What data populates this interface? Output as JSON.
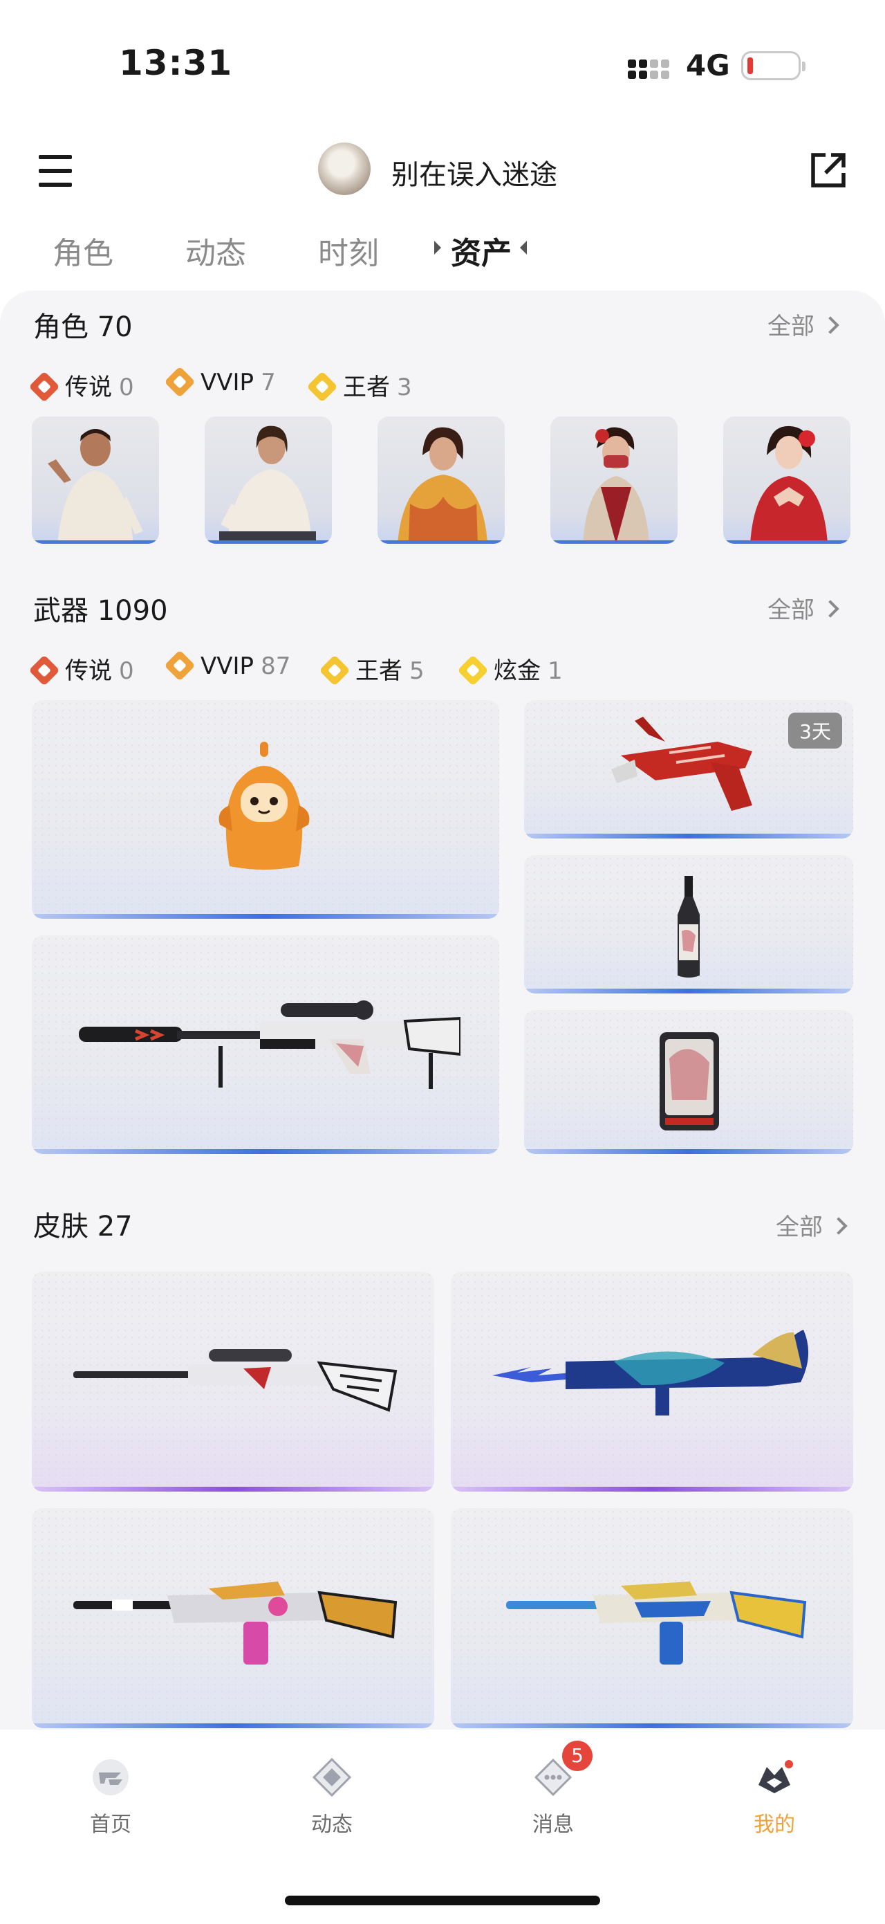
{
  "status_bar": {
    "time": "13:31",
    "network": "4G"
  },
  "header": {
    "username": "别在误入迷途"
  },
  "tabs": [
    {
      "label": "角色",
      "active": false
    },
    {
      "label": "动态",
      "active": false
    },
    {
      "label": "时刻",
      "active": false
    },
    {
      "label": "资产",
      "active": true
    }
  ],
  "roles": {
    "title": "角色",
    "count": "70",
    "see_all": "全部",
    "filters": [
      {
        "label": "传说",
        "count": "0",
        "icon": "legend-badge-icon"
      },
      {
        "label": "VVIP",
        "count": "7",
        "icon": "vvip-badge-icon"
      },
      {
        "label": "王者",
        "count": "3",
        "icon": "king-badge-icon"
      }
    ]
  },
  "weapons": {
    "title": "武器",
    "count": "1090",
    "see_all": "全部",
    "filters": [
      {
        "label": "传说",
        "count": "0",
        "icon": "legend-badge-icon"
      },
      {
        "label": "VVIP",
        "count": "87",
        "icon": "vvip-badge-icon"
      },
      {
        "label": "王者",
        "count": "5",
        "icon": "king-badge-icon"
      },
      {
        "label": "炫金",
        "count": "1",
        "icon": "gold-badge-icon"
      }
    ],
    "expiry_tag": "3天"
  },
  "skins": {
    "title": "皮肤",
    "count": "27",
    "see_all": "全部"
  },
  "bottom_nav": [
    {
      "label": "首页",
      "active": false
    },
    {
      "label": "动态",
      "active": false
    },
    {
      "label": "消息",
      "active": false,
      "badge": "5"
    },
    {
      "label": "我的",
      "active": true
    }
  ],
  "colors": {
    "accent": "#f0a23a",
    "legend": "#e05a3a",
    "vvip": "#f0a23a",
    "king": "#f5c531",
    "notification": "#e5453a",
    "rarity_blue": "#3e6ee0",
    "rarity_purple": "#8a4ee0"
  }
}
